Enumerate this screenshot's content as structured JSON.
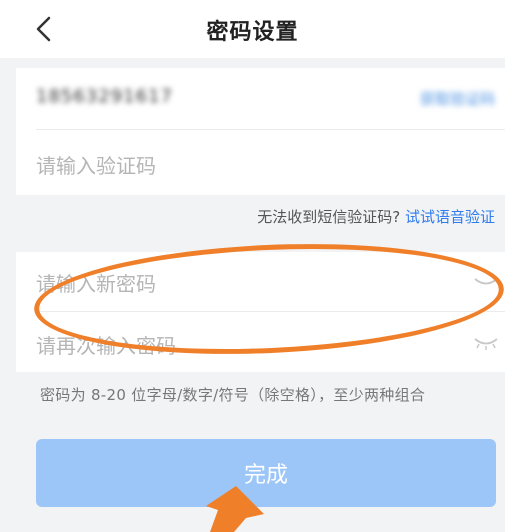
{
  "header": {
    "title": "密码设置",
    "back_icon": "chevron-left-icon"
  },
  "form": {
    "phone_value": "18563291617",
    "get_code_label": "获取验证码",
    "code_placeholder": "请输入验证码",
    "help_text": "无法收到短信验证码?",
    "voice_link": "试试语音验证",
    "new_password_placeholder": "请输入新密码",
    "confirm_password_placeholder": "请再次输入密码",
    "password_rule": "密码为 8-20 位字母/数字/符号（除空格），至少两种组合"
  },
  "submit": {
    "label": "完成"
  },
  "colors": {
    "accent": "#2f7cf0",
    "button": "#9cc6f8",
    "annotation": "#f07f2a"
  }
}
